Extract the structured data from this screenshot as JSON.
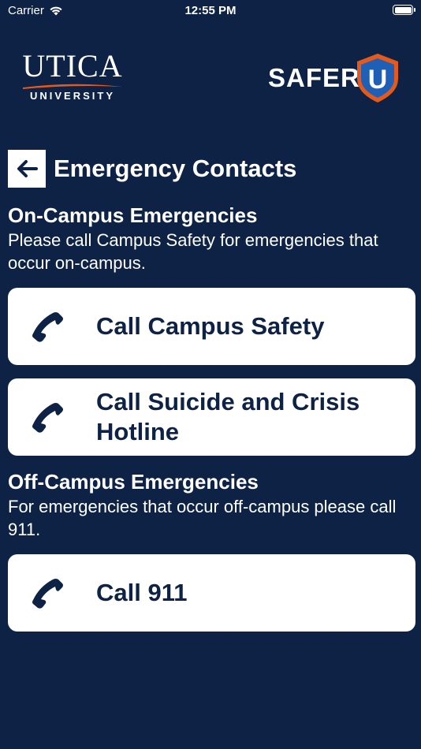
{
  "status_bar": {
    "carrier": "Carrier",
    "time": "12:55 PM"
  },
  "header": {
    "left_logo": {
      "word": "UTICA",
      "sub": "UNIVERSITY"
    },
    "right_logo": {
      "text": "SAFER",
      "shield_letter": "U"
    }
  },
  "page": {
    "title": "Emergency Contacts"
  },
  "on_campus": {
    "heading": "On-Campus Emergencies",
    "description": "Please call Campus Safety for emergencies that occur on-campus.",
    "buttons": [
      {
        "label": "Call Campus Safety",
        "icon": "phone-icon"
      },
      {
        "label": "Call Suicide and Crisis Hotline",
        "icon": "phone-icon"
      }
    ]
  },
  "off_campus": {
    "heading": "Off-Campus Emergencies",
    "description": "For emergencies that occur off-campus please call 911.",
    "buttons": [
      {
        "label": "Call 911",
        "icon": "phone-icon"
      }
    ]
  },
  "colors": {
    "background": "#0d2244",
    "card": "#ffffff",
    "accent_orange": "#e35a1c",
    "shield_blue": "#1f5fb5"
  }
}
